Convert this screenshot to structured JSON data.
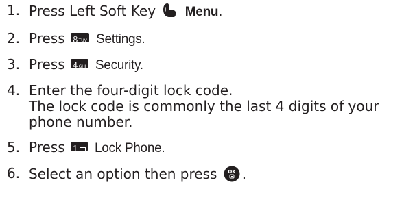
{
  "steps": [
    {
      "number": "1.",
      "prefix": "Press Left Soft Key",
      "icon": "left-soft-key-icon",
      "suffix": "Menu",
      "end": "."
    },
    {
      "number": "2.",
      "prefix": "Press",
      "key": {
        "digit": "8",
        "letters": "TUV"
      },
      "suffix": "Settings."
    },
    {
      "number": "3.",
      "prefix": "Press",
      "key": {
        "digit": "4",
        "letters": "GHI"
      },
      "suffix": "Security."
    },
    {
      "number": "4.",
      "text": "Enter the four-digit lock code.",
      "note": "The lock code is commonly the last 4 digits of your phone number."
    },
    {
      "number": "5.",
      "prefix": "Press",
      "key": {
        "digit": "1",
        "icon": "envelope-icon"
      },
      "suffix": "Lock Phone."
    },
    {
      "number": "6.",
      "prefix": "Select an option then press",
      "icon": "ok-key-icon",
      "ok_label": "OK",
      "end": "."
    }
  ],
  "colors": {
    "text": "#231f20",
    "key_bg": "#231f20",
    "key_text": "#ffffff"
  }
}
